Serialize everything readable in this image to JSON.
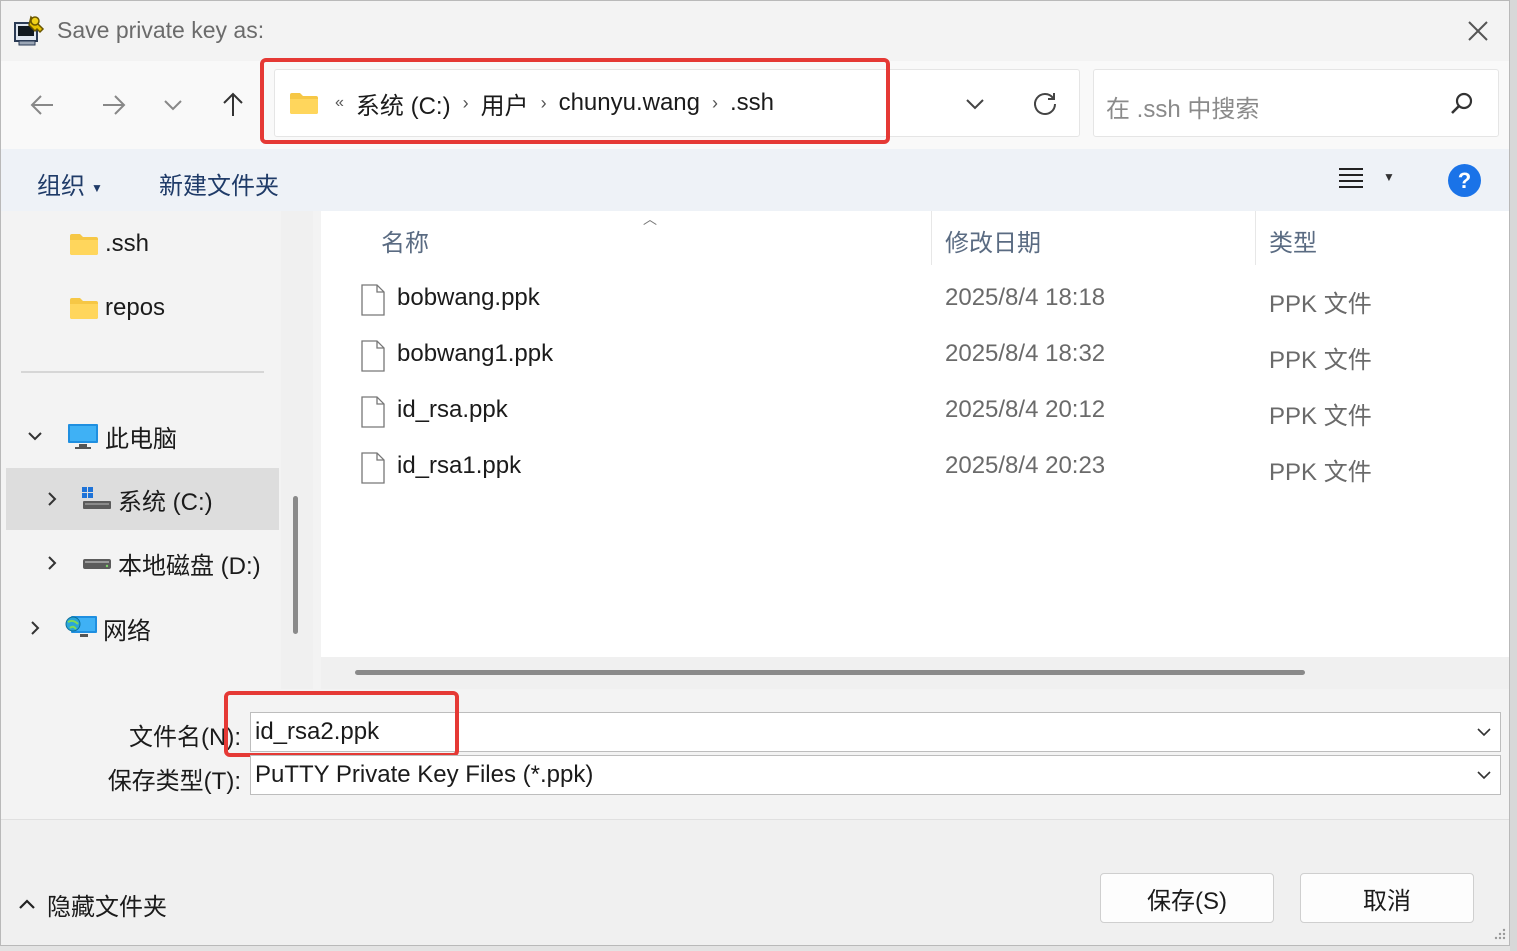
{
  "window": {
    "title": "Save private key as:"
  },
  "nav": {
    "breadcrumbs": [
      "系统 (C:)",
      "用户",
      "chunyu.wang",
      ".ssh"
    ],
    "more_glyph": "«"
  },
  "search": {
    "placeholder": "在 .ssh 中搜索"
  },
  "toolbar": {
    "organize_label": "组织",
    "new_folder_label": "新建文件夹",
    "help_label": "?"
  },
  "sidebar": {
    "items": [
      {
        "label": ".ssh",
        "icon": "folder-icon"
      },
      {
        "label": "repos",
        "icon": "folder-icon"
      },
      {
        "label": "此电脑",
        "icon": "monitor-icon"
      },
      {
        "label": "系统 (C:)",
        "icon": "system-drive-icon"
      },
      {
        "label": "本地磁盘 (D:)",
        "icon": "drive-icon"
      },
      {
        "label": "网络",
        "icon": "network-icon"
      }
    ]
  },
  "filelist": {
    "columns": {
      "name": "名称",
      "date": "修改日期",
      "type": "类型"
    },
    "rows": [
      {
        "name": "bobwang.ppk",
        "date": "2025/8/4 18:18",
        "type": "PPK 文件"
      },
      {
        "name": "bobwang1.ppk",
        "date": "2025/8/4 18:32",
        "type": "PPK 文件"
      },
      {
        "name": "id_rsa.ppk",
        "date": "2025/8/4 20:12",
        "type": "PPK 文件"
      },
      {
        "name": "id_rsa1.ppk",
        "date": "2025/8/4 20:23",
        "type": "PPK 文件"
      }
    ]
  },
  "form": {
    "filename_label": "文件名(N):",
    "filename_value": "id_rsa2.ppk",
    "filetype_label": "保存类型(T):",
    "filetype_value": "PuTTY Private Key Files (*.ppk)"
  },
  "footer": {
    "hide_folders_label": "隐藏文件夹",
    "save_label": "保存(S)",
    "cancel_label": "取消"
  },
  "colors": {
    "highlight_red": "#e53935",
    "link_blue": "#1f3b68",
    "help_blue": "#1a73e8"
  }
}
